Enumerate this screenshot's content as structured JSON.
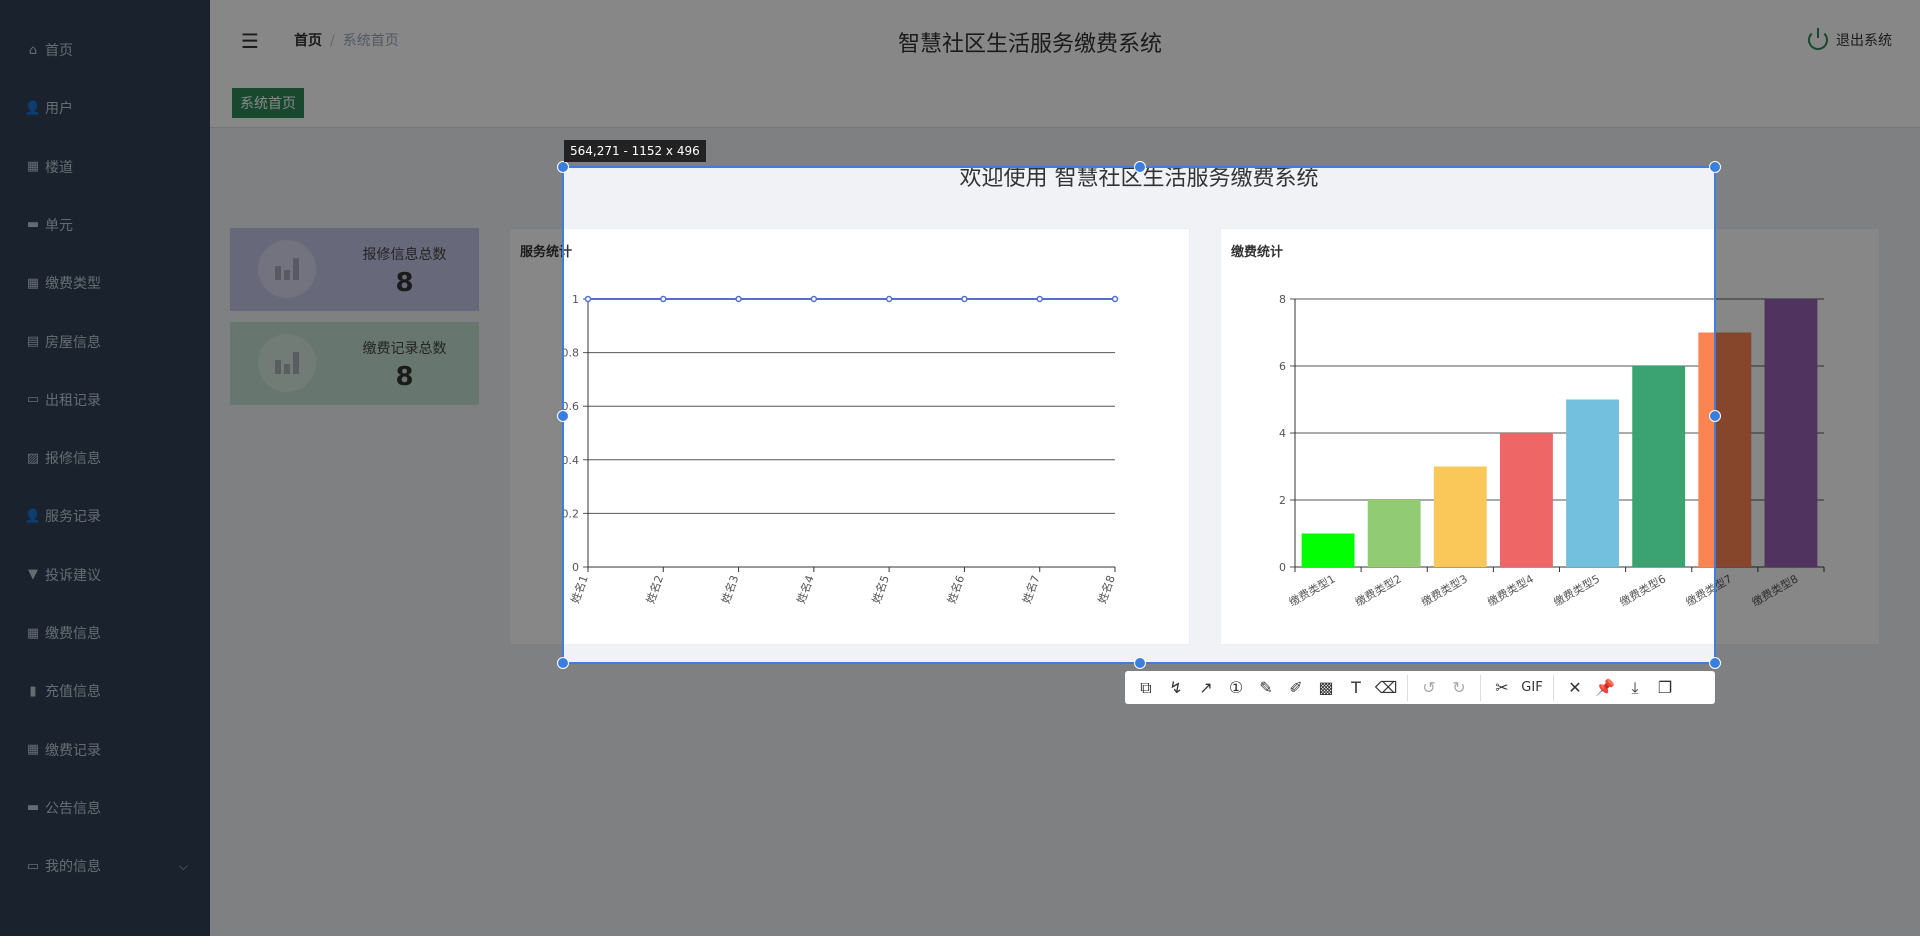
{
  "sidebar": {
    "items": [
      {
        "label": "首页",
        "icon": "home-icon"
      },
      {
        "label": "用户",
        "icon": "user-icon"
      },
      {
        "label": "楼道",
        "icon": "grid-icon"
      },
      {
        "label": "单元",
        "icon": "briefcase-icon"
      },
      {
        "label": "缴费类型",
        "icon": "grid-icon"
      },
      {
        "label": "房屋信息",
        "icon": "clipboard-icon"
      },
      {
        "label": "出租记录",
        "icon": "printer-icon"
      },
      {
        "label": "报修信息",
        "icon": "chart-icon"
      },
      {
        "label": "服务记录",
        "icon": "user-icon"
      },
      {
        "label": "投诉建议",
        "icon": "pin-icon"
      },
      {
        "label": "缴费信息",
        "icon": "grid-icon"
      },
      {
        "label": "充值信息",
        "icon": "bar-chart-icon"
      },
      {
        "label": "缴费记录",
        "icon": "grid-icon"
      },
      {
        "label": "公告信息",
        "icon": "ticket-icon"
      },
      {
        "label": "我的信息",
        "icon": "card-icon"
      }
    ]
  },
  "header": {
    "breadcrumb": [
      "首页",
      "系统首页"
    ],
    "title": "智慧社区生活服务缴费系统",
    "logout": "退出系统"
  },
  "tabs": [
    {
      "label": "系统首页",
      "active": true
    }
  ],
  "main": {
    "welcome": "欢迎使用 智慧社区生活服务缴费系统",
    "stats": [
      {
        "label": "报修信息总数",
        "value": "8",
        "color": "#c5c5e8"
      },
      {
        "label": "缴费记录总数",
        "value": "8",
        "color": "#c2e0d2"
      }
    ]
  },
  "screenshot_tool": {
    "size_label": "564,271 - 1152 x 496",
    "tools": [
      "shape-icon",
      "polyline-icon",
      "arrow-icon",
      "number-marker-icon",
      "pencil-icon",
      "highlighter-icon",
      "mosaic-icon",
      "text-icon",
      "eraser-icon",
      "undo-icon",
      "redo-icon",
      "scissors-icon",
      "GIF",
      "close-icon",
      "pin-icon",
      "download-icon",
      "copy-icon"
    ]
  },
  "chart_data": [
    {
      "type": "line",
      "title": "服务统计",
      "categories": [
        "姓名1",
        "姓名2",
        "姓名3",
        "姓名4",
        "姓名5",
        "姓名6",
        "姓名7",
        "姓名8"
      ],
      "values": [
        1,
        1,
        1,
        1,
        1,
        1,
        1,
        1
      ],
      "ylim": [
        0,
        1
      ],
      "yticks": [
        "0",
        "0.2",
        "0.4",
        "0.6",
        "0.8",
        "1"
      ],
      "grid": true,
      "color": "#5470c6"
    },
    {
      "type": "bar",
      "title": "缴费统计",
      "categories": [
        "缴费类型1",
        "缴费类型2",
        "缴费类型3",
        "缴费类型4",
        "缴费类型5",
        "缴费类型6",
        "缴费类型7",
        "缴费类型8"
      ],
      "values": [
        1,
        2,
        3,
        4,
        5,
        6,
        7,
        8
      ],
      "ylim": [
        0,
        8
      ],
      "yticks": [
        "0",
        "2",
        "4",
        "6",
        "8"
      ],
      "grid": true,
      "colors": [
        "#00ff00",
        "#91cc75",
        "#fac858",
        "#ee6666",
        "#73c0de",
        "#3ba272",
        "#fc8452",
        "#9a60b4"
      ]
    }
  ]
}
